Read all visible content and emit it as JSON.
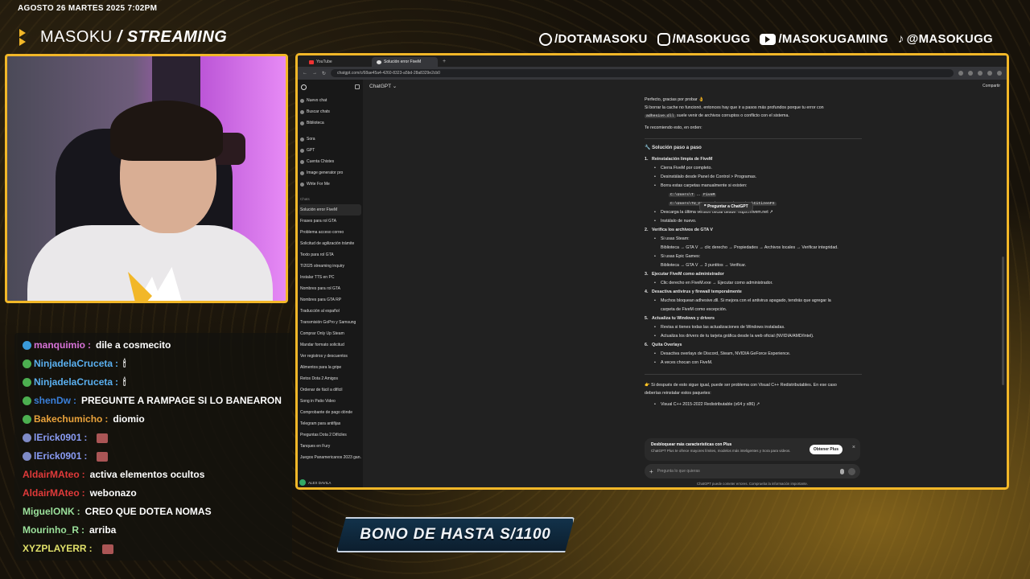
{
  "overlay": {
    "datetime": "AGOSTO 26 MARTES 2025 7:02PM",
    "brand_first": "MASOKU",
    "brand_sep": " / ",
    "brand_second": "STREAMING",
    "socials": [
      {
        "icon": "facebook-icon",
        "handle": "/DOTAMASOKU"
      },
      {
        "icon": "instagram-icon",
        "handle": "/MASOKUGG"
      },
      {
        "icon": "youtube-icon",
        "handle": "/MASOKUGAMING"
      },
      {
        "icon": "tiktok-icon",
        "handle": "@MASOKUGG"
      }
    ],
    "bono": "BONO DE HASTA S/1100",
    "accent": "#f2b728"
  },
  "chat": [
    {
      "user": "manquimio",
      "color": "#d873d8",
      "badge": "#3a9ad9",
      "text": "dile a cosmecito",
      "emote": false
    },
    {
      "user": "NinjadelaCruceta",
      "color": "#5ab0f0",
      "badge": "#4caf50",
      "text": "🕯",
      "emote": false
    },
    {
      "user": "NinjadelaCruceta",
      "color": "#5ab0f0",
      "badge": "#4caf50",
      "text": "🕯",
      "emote": false
    },
    {
      "user": "shenDw",
      "color": "#3a7fd9",
      "badge": "#4caf50",
      "text": "PREGUNTE A RAMPAGE SI LO BANEARON",
      "emote": false
    },
    {
      "user": "Bakechumicho",
      "color": "#e9a23b",
      "badge": "#4caf50",
      "text": "diomio",
      "emote": false
    },
    {
      "user": "lErick0901",
      "color": "#8a9cf5",
      "badge": "#7f8bc7",
      "text": "",
      "emote": true
    },
    {
      "user": "lErick0901",
      "color": "#8a9cf5",
      "badge": "#7f8bc7",
      "text": "",
      "emote": true
    },
    {
      "user": "AldairMAteo",
      "color": "#e03a3a",
      "badge": "",
      "text": "activa elementos ocultos",
      "emote": false
    },
    {
      "user": "AldairMAteo",
      "color": "#e03a3a",
      "badge": "",
      "text": "webonazo",
      "emote": false
    },
    {
      "user": "MiguelONK",
      "color": "#9be09b",
      "badge": "",
      "text": "CREO QUE DOTEA NOMAS",
      "emote": false
    },
    {
      "user": "Mourinho_R",
      "color": "#9be09b",
      "badge": "",
      "text": "arriba",
      "emote": false
    },
    {
      "user": "XYZPLAYERR",
      "color": "#e0e06a",
      "badge": "",
      "text": "",
      "emote": true
    }
  ],
  "browser": {
    "tabs": [
      {
        "label": "YouTube",
        "active": false
      },
      {
        "label": "Solución error FiveM",
        "active": true
      }
    ],
    "url": "chatgpt.com/c/68ae45a4-4260-8323-a5bd-28a8329e2cb0",
    "share_label": "Compartir",
    "model_label": "ChatGPT ⌄",
    "sidebar": {
      "items": [
        "Nuevo chat",
        "Buscar chats",
        "Biblioteca"
      ],
      "gpts": [
        "Sora",
        "GPT",
        "Cuenta Chistes",
        "Image generator pro",
        "Write For Me"
      ],
      "section": "Chats",
      "chats": [
        "Solución error FiveM",
        "Frases para rol GTA",
        "Problema acceso correo",
        "Solicitud de agilización trámite",
        "Texto para rol GTA",
        "TI2025 streaming inquiry",
        "Instalar TTS en PC",
        "Nombres para rol GTA",
        "Nombres para GTA RP",
        "Traducción al español",
        "Transmisión GoPro y Samsung",
        "Comprar Only Up Steam",
        "Mandar formato solicitud",
        "Ver registros y descuentos",
        "Alimentos para la gripe",
        "Retos Dota 2 Amigos",
        "Ordenar de fácil a difícil",
        "Song in Patio Video",
        "Comprobante de pago dónde",
        "Telegram para antifijas",
        "Preguntas Dota 2 Difíciles",
        "Tanques en Fury",
        "Juegos Panamericanos 2023 gan..."
      ],
      "user": "ALEX DAVILA"
    },
    "convo": {
      "intro1": "Perfecto, gracias por probar 👌",
      "intro2a": "Si borrar la cache no funcionó, entonces hay que ir a pasos más profundos porque tu error con",
      "intro2code": "adhesive.dll",
      "intro2b": " suele venir de archivos corruptos o conflicto con el sistema.",
      "intro3": "Te recomiendo esto, en orden:",
      "heading": "🔧 Solución paso a paso",
      "step1": "Reinstalación limpia de FiveM",
      "s1a": "Cierra FiveM por completo.",
      "s1b": "Desinstálalo desde Panel de Control > Programas.",
      "s1c": "Borra estas carpetas manualmente si existen:",
      "path1": "C:\\Users\\T",
      "path1b": "FiveM",
      "path2": "C:\\Users\\TU_USUARIO\\AppData\\Roaming\\CitizenFX",
      "tooltip": "❞ Preguntar a ChatGPT",
      "s1d": "Descarga la última versión oficial desde: https://fivem.net ↗",
      "s1e": "Instálalo de nuevo.",
      "step2": "Verifica los archivos de GTA V",
      "s2a": "Si usas Steam:",
      "s2b": "Biblioteca → GTA V → clic derecho → Propiedades → Archivos locales → Verificar integridad.",
      "s2c": "Si usas Epic Games:",
      "s2d": "Biblioteca → GTA V → 3 puntitos → Verificar.",
      "step3": "Ejecutar FiveM como administrador",
      "s3a": "Clic derecho en FiveM.exe → Ejecutar como administrador.",
      "step4": "Desactiva antivirus y firewall temporalmente",
      "s4a": "Muchos bloquean adhesive.dll. Si mejora con el antivirus apagado, tendrás que agregar la",
      "s4b": "carpeta de FiveM como excepción.",
      "step5": "Actualiza tu Windows y drivers",
      "s5a": "Revisa si tienes todas las actualizaciones de Windows instaladas.",
      "s5b": "Actualiza los drivers de tu tarjeta gráfica desde la web oficial (NVIDIA/AMD/Intel).",
      "step6": "Quita Overlays",
      "s6a": "Desactiva overlays de Discord, Steam, NVIDIA GeForce Experience.",
      "s6b": "A veces chocan con FiveM.",
      "outro1": "👉 Si después de esto sigue igual, puede ser problema con Visual C++ Redistributables. En ese caso",
      "outro2": "deberías reinstalar estos paquetes:",
      "outro3": "Visual C++ 2015-2022 Redistributable (x64 y x86) ↗"
    },
    "plus_banner": {
      "title": "Desbloquear más características con Plus",
      "desc": "ChatGPT Plus te ofrece mayores límites, modelos más inteligentes y Sora para videos.",
      "button": "Obtener Plus"
    },
    "composer_placeholder": "Pregunta lo que quieras",
    "disclaimer": "ChatGPT puede cometer errores. Comprueba la información importante."
  }
}
